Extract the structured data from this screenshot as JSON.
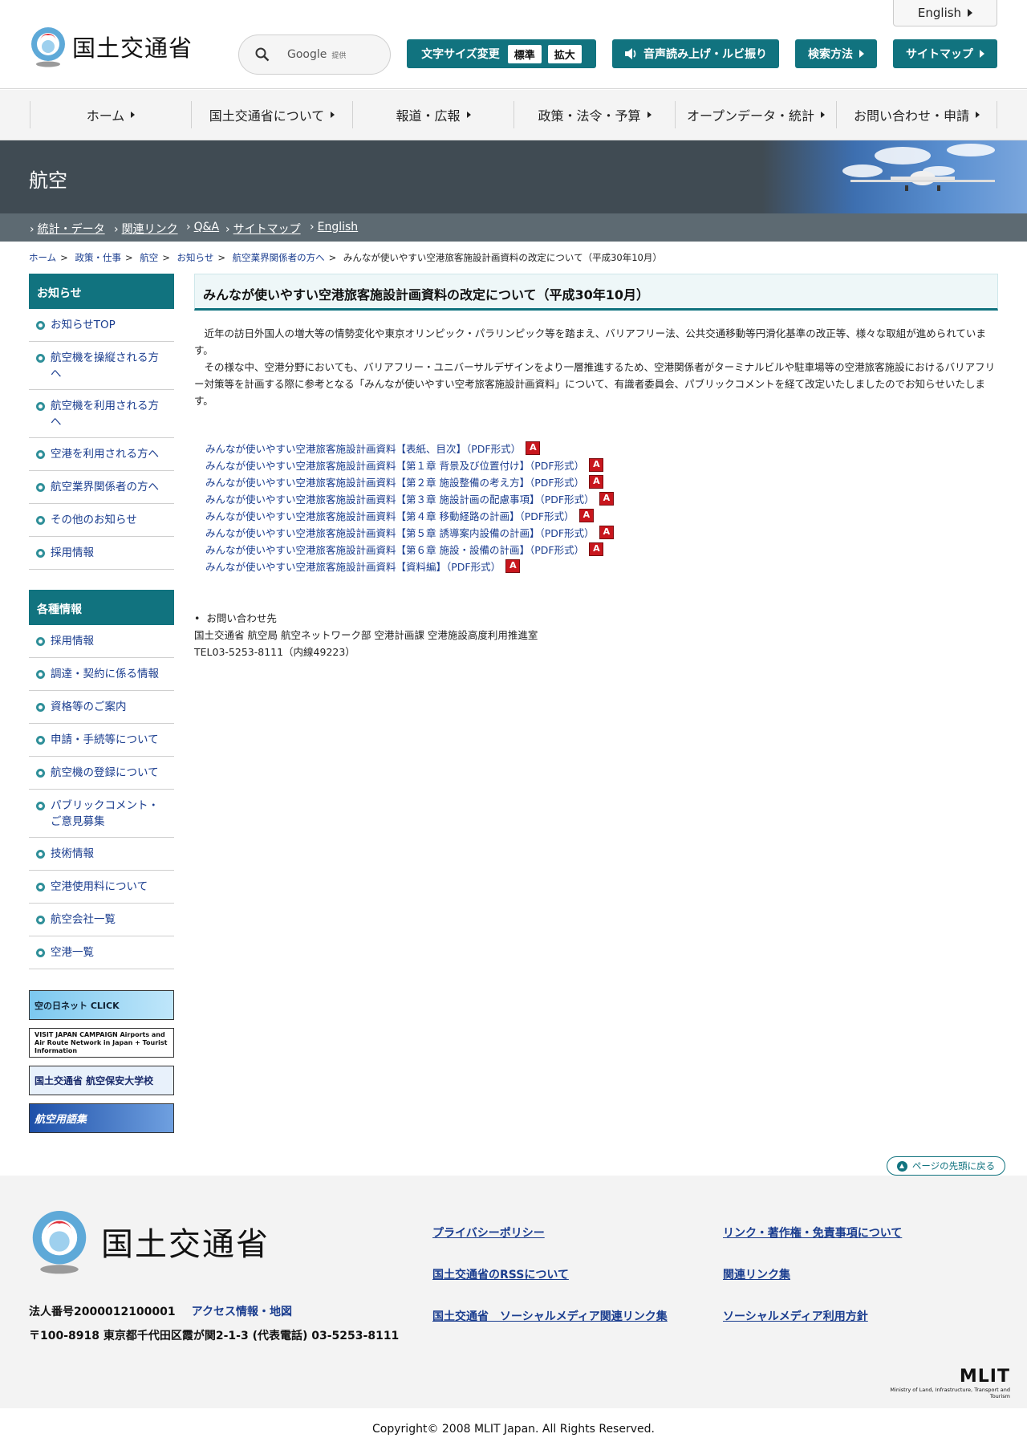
{
  "header": {
    "logo_text": "国土交通省",
    "search_brand": "Google",
    "search_brand_suffix": "提供",
    "english": "English",
    "font_size_label": "文字サイズ変更",
    "font_size_standard": "標準",
    "font_size_large": "拡大",
    "read_aloud": "音声読み上げ・ルビ振り",
    "search_method": "検索方法",
    "sitemap": "サイトマップ",
    "accent_color": "#11737f"
  },
  "gnav": [
    {
      "label": "ホーム"
    },
    {
      "label": "国土交通省について"
    },
    {
      "label": "報道・広報"
    },
    {
      "label": "政策・法令・予算"
    },
    {
      "label": "オープンデータ・統計"
    },
    {
      "label": "お問い合わせ・申請"
    }
  ],
  "section": {
    "title": "航空",
    "subnav": [
      "統計・データ",
      "関連リンク",
      "Q&A",
      "サイトマップ",
      "English"
    ]
  },
  "breadcrumb": [
    "ホーム",
    "政策・仕事",
    "航空",
    "お知らせ",
    "航空業界関係者の方へ",
    "みんなが使いやすい空港旅客施設計画資料の改定について（平成30年10月）"
  ],
  "sidebar": {
    "notices_title": "お知らせ",
    "notices": [
      "お知らせTOP",
      "航空機を操縦される方へ",
      "航空機を利用される方へ",
      "空港を利用される方へ",
      "航空業界関係者の方へ",
      "その他のお知らせ",
      "採用情報"
    ],
    "info_title": "各種情報",
    "info": [
      "採用情報",
      "調達・契約に係る情報",
      "資格等のご案内",
      "申請・手続等について",
      "航空機の登録について",
      "パブリックコメント・ご意見募集",
      "技術情報",
      "空港使用料について",
      "航空会社一覧",
      "空港一覧"
    ],
    "banners": [
      "空の日ネット CLICK",
      "VISIT JAPAN CAMPAIGN Airports and Air Route Network in Japan + Tourist Information",
      "国土交通省 航空保安大学校",
      "航空用語集"
    ]
  },
  "main": {
    "title": "みんなが使いやすい空港旅客施設計画資料の改定について（平成30年10月）",
    "paragraph1": "近年の訪日外国人の増大等の情勢変化や東京オリンピック・パラリンピック等を踏まえ、バリアフリー法、公共交通移動等円滑化基準の改正等、様々な取組が進められています。",
    "paragraph2": "その様な中、空港分野においても、バリアフリー・ユニバーサルデザインをより一層推進するため、空港関係者がターミナルビルや駐車場等の空港旅客施設におけるバリアフリー対策等を計画する際に参考となる「みんなが使いやすい空考旅客施設計画資料」について、有識者委員会、パブリックコメントを経て改定いたしましたのでお知らせいたします。",
    "files": [
      "みんなが使いやすい空港旅客施設計画資料【表紙、目次】（PDF形式）",
      "みんなが使いやすい空港旅客施設計画資料【第１章 背景及び位置付け】（PDF形式）",
      "みんなが使いやすい空港旅客施設計画資料【第２章 施設整備の考え方】（PDF形式）",
      "みんなが使いやすい空港旅客施設計画資料【第３章 施設計画の配慮事項】（PDF形式）",
      "みんなが使いやすい空港旅客施設計画資料【第４章 移動経路の計画】（PDF形式）",
      "みんなが使いやすい空港旅客施設計画資料【第５章 誘導案内設備の計画】（PDF形式）",
      "みんなが使いやすい空港旅客施設計画資料【第６章 施設・設備の計画】（PDF形式）",
      "みんなが使いやすい空港旅客施設計画資料【資料編】（PDF形式）"
    ],
    "contact_label": "お問い合わせ先",
    "contact_org": "国土交通省 航空局 航空ネットワーク部 空港計画課 空港施設高度利用推進室",
    "contact_tel": "TEL03-5253-8111（内線49223）"
  },
  "footer": {
    "to_top": "ページの先頭に戻る",
    "logo_text": "国土交通省",
    "corp_number": "法人番号2000012100001",
    "access": "アクセス情報・地図",
    "address": "〒100-8918 東京都千代田区霞が関2-1-3 (代表電話) 03-5253-8111",
    "links": [
      "プライバシーポリシー",
      "リンク・著作権・免責事項について",
      "国土交通省のRSSについて",
      "関連リンク集",
      "国土交通省　ソーシャルメディア関連リンク集",
      "ソーシャルメディア利用方針"
    ],
    "mlit": "MLIT",
    "mlit_sub": "Ministry of Land, Infrastructure, Transport and Tourism",
    "copyright": "Copyright© 2008 MLIT Japan. All Rights Reserved."
  }
}
